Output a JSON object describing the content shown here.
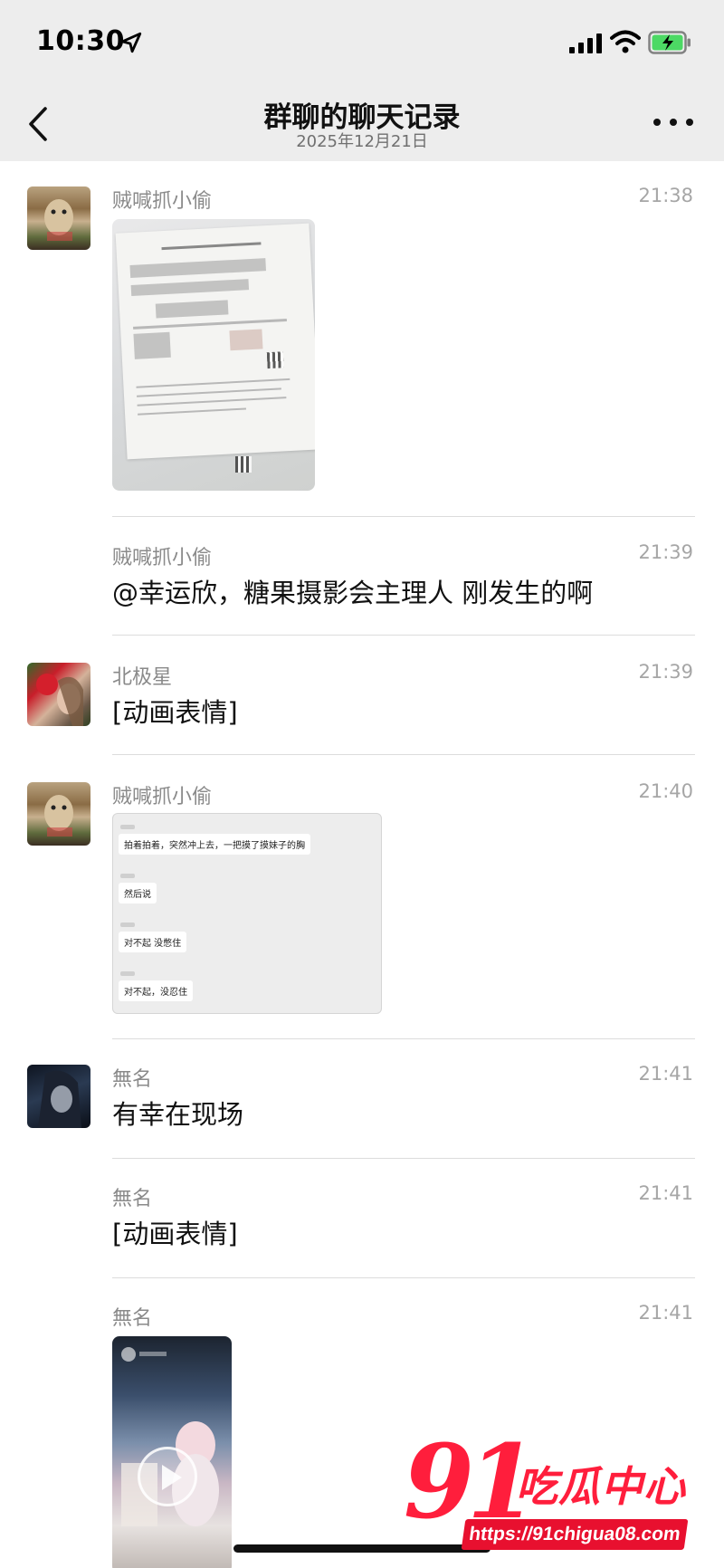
{
  "status_bar": {
    "time": "10:30",
    "icons": [
      "location-arrow-icon",
      "signal-icon",
      "wifi-icon",
      "battery-charging-icon"
    ]
  },
  "nav": {
    "title": "群聊的聊天记录",
    "date": "2025年12月21日",
    "back_icon": "chevron-left-icon",
    "more_icon": "ellipsis-icon"
  },
  "messages": [
    {
      "sender": "贼喊抓小偷",
      "time": "21:38",
      "type": "image",
      "image": "document-photo"
    },
    {
      "sender": "贼喊抓小偷",
      "time": "21:39",
      "type": "text",
      "text": "@幸运欣，糖果摄影会主理人 刚发生的啊"
    },
    {
      "sender": "北极星",
      "time": "21:39",
      "type": "text",
      "text": "[动画表情]"
    },
    {
      "sender": "贼喊抓小偷",
      "time": "21:40",
      "type": "image",
      "image": "chat-screenshot",
      "screenshot_lines": [
        "拍着拍着，突然冲上去，一把摸了摸妹子的胸",
        "然后说",
        "对不起 没憋住",
        "对不起，没忍住"
      ]
    },
    {
      "sender": "無名",
      "time": "21:41",
      "type": "text",
      "text": "有幸在现场"
    },
    {
      "sender": "無名",
      "time": "21:41",
      "type": "text",
      "text": "[动画表情]"
    },
    {
      "sender": "無名",
      "time": "21:41",
      "type": "video",
      "image": "video-thumbnail"
    }
  ],
  "watermark": {
    "number": "91",
    "name": "吃瓜中心",
    "url": "https://91chigua08.com",
    "color": "#ff1e3c"
  }
}
